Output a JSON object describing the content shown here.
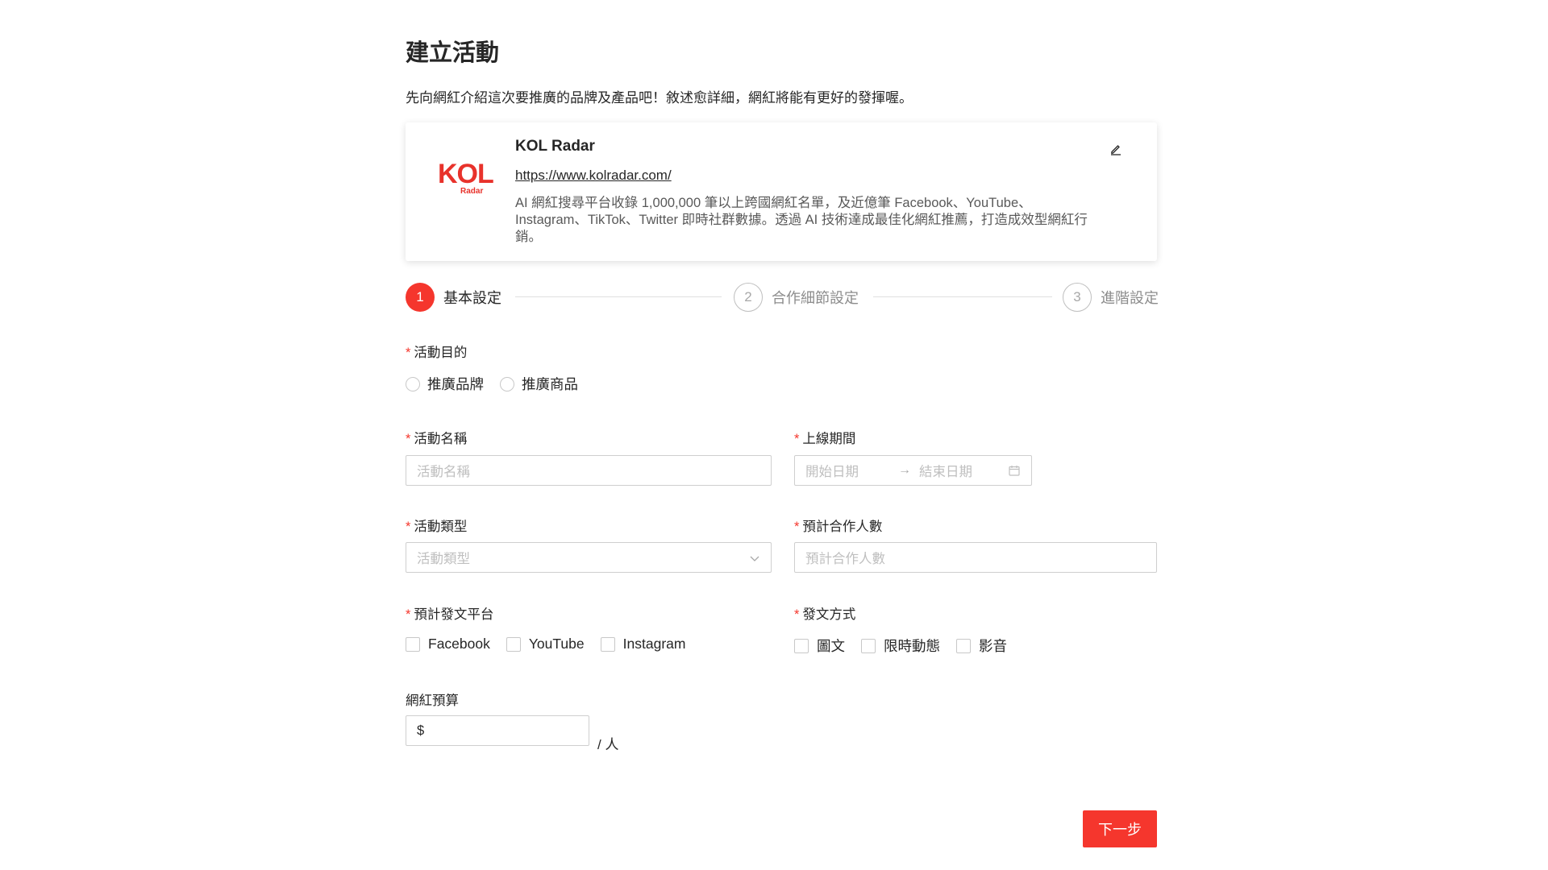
{
  "page": {
    "title": "建立活動",
    "description": "先向網紅介紹這次要推廣的品牌及產品吧！敘述愈詳細，網紅將能有更好的發揮喔。"
  },
  "brand": {
    "logo_text": "KOL",
    "logo_subtext": "Radar",
    "name": "KOL Radar",
    "url": "https://www.kolradar.com/",
    "description": "AI 網紅搜尋平台收錄 1,000,000 筆以上跨國網紅名單，及近億筆 Facebook、YouTube、Instagram、TikTok、Twitter 即時社群數據。透過 AI 技術達成最佳化網紅推薦，打造成效型網紅行銷。",
    "logo_color": "#e8322b"
  },
  "steps": [
    {
      "number": "1",
      "label": "基本設定",
      "state": "active"
    },
    {
      "number": "2",
      "label": "合作細節設定",
      "state": "inactive"
    },
    {
      "number": "3",
      "label": "進階設定",
      "state": "inactive"
    }
  ],
  "form": {
    "required_mark": "*",
    "purpose": {
      "label": "活動目的",
      "options": [
        "推廣品牌",
        "推廣商品"
      ]
    },
    "name": {
      "label": "活動名稱",
      "placeholder": "活動名稱"
    },
    "period": {
      "label": "上線期間",
      "start_placeholder": "開始日期",
      "arrow": "→",
      "end_placeholder": "結束日期"
    },
    "type": {
      "label": "活動類型",
      "placeholder": "活動類型"
    },
    "headcount": {
      "label": "預計合作人數",
      "placeholder": "預計合作人數"
    },
    "platforms": {
      "label": "預計發文平台",
      "options": [
        "Facebook",
        "YouTube",
        "Instagram"
      ]
    },
    "post_types": {
      "label": "發文方式",
      "options": [
        "圖文",
        "限時動態",
        "影音"
      ]
    },
    "budget": {
      "label": "網紅預算",
      "prefix": "$",
      "unit": "/ 人"
    }
  },
  "actions": {
    "next_label": "下一步"
  },
  "colors": {
    "accent": "#f5362d",
    "border": "#cfcfcf",
    "placeholder": "#bfbfbf"
  }
}
